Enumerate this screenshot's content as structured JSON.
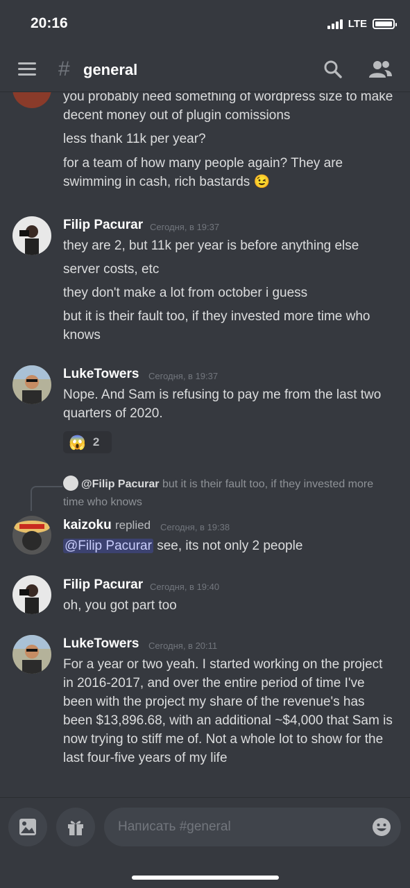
{
  "status_bar": {
    "time": "20:16",
    "network": "LTE"
  },
  "header": {
    "hash": "#",
    "channel": "general"
  },
  "colors": {
    "background": "#36393f",
    "accent": "#5865f2",
    "mention_bg": "#3c4270"
  },
  "messages": {
    "m0": {
      "lines": [
        "you probably need something of wordpress size to make decent money out of plugin comissions",
        "less thank 11k per year?",
        "for a team of how many people again? They are swimming in cash, rich bastards 😉"
      ]
    },
    "m1": {
      "author": "Filip Pacurar",
      "timestamp": "Сегодня, в 19:37",
      "lines": [
        "they are 2, but 11k per year is before anything else",
        "server costs, etc",
        "they don't make a lot from october i guess",
        "but it is their fault too, if they invested more time who knows"
      ]
    },
    "m2": {
      "author": "LukeTowers",
      "timestamp": "Сегодня, в 19:37",
      "lines": [
        "Nope. And Sam is refusing to pay me from the last two quarters of 2020."
      ],
      "reaction": {
        "emoji": "😱",
        "count": "2"
      }
    },
    "m3": {
      "reply_to_author": "@Filip Pacurar",
      "reply_to_text": "but it is their fault too, if they invested more time who knows",
      "author": "kaizoku",
      "replied_label": "replied",
      "timestamp": "Сегодня, в 19:38",
      "mention": "@Filip Pacurar",
      "text": " see, its not only 2 people"
    },
    "m4": {
      "author": "Filip Pacurar",
      "timestamp": "Сегодня, в 19:40",
      "lines": [
        "oh, you got part too"
      ]
    },
    "m5": {
      "author": "LukeTowers",
      "timestamp": "Сегодня, в 20:11",
      "lines": [
        "For a year or two yeah. I started working on the project in 2016-2017, and over the entire period of time I've been with the project my share of the revenue's has been $13,896.68, with an additional ~$4,000 that Sam is now trying to stiff me of. Not a whole lot to show for the last four-five years of my life"
      ]
    }
  },
  "composer": {
    "placeholder": "Написать #general"
  }
}
